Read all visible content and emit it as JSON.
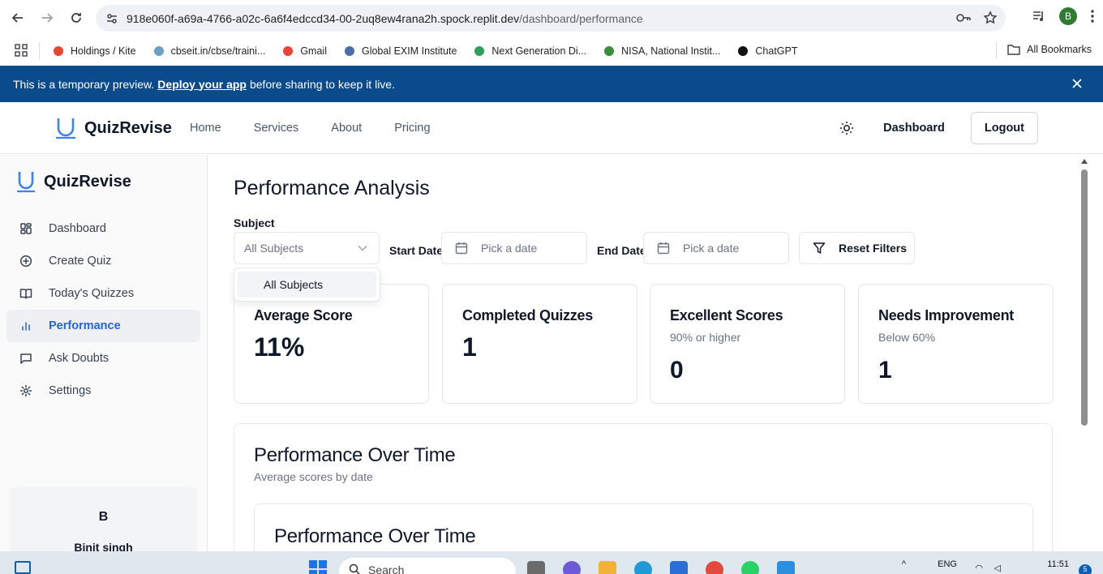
{
  "browser": {
    "url_host": "918e060f-a69a-4766-a02c-6a6f4edccd34-00-2uq8ew4rana2h.spock.replit.dev",
    "url_path": "/dashboard/performance",
    "profile_initial": "B",
    "bookmarks": [
      {
        "label": "Holdings / Kite",
        "icon": "kite-icon",
        "color": "#e8452c"
      },
      {
        "label": "cbseit.in/cbse/traini...",
        "icon": "cbse-icon",
        "color": "#6aa0c8"
      },
      {
        "label": "Gmail",
        "icon": "gmail-icon",
        "color": "#ea4335"
      },
      {
        "label": "Global EXIM Institute",
        "icon": "globe-icon",
        "color": "#4a6fa5"
      },
      {
        "label": "Next Generation Di...",
        "icon": "arrow-icon",
        "color": "#2e9e5b"
      },
      {
        "label": "NISA, National Instit...",
        "icon": "nisa-icon",
        "color": "#3b8d3b"
      },
      {
        "label": "ChatGPT",
        "icon": "chatgpt-icon",
        "color": "#111111"
      }
    ],
    "all_bookmarks": "All Bookmarks"
  },
  "banner": {
    "pre": "This is a temporary preview.",
    "link": "Deploy your app",
    "post": "before sharing to keep it live."
  },
  "header": {
    "brand": "QuizRevise",
    "nav": [
      "Home",
      "Services",
      "About",
      "Pricing"
    ],
    "dashboard": "Dashboard",
    "logout": "Logout"
  },
  "sidebar": {
    "brand": "QuizRevise",
    "items": [
      {
        "label": "Dashboard",
        "icon": "grid-icon",
        "active": false
      },
      {
        "label": "Create Quiz",
        "icon": "plus-circle-icon",
        "active": false
      },
      {
        "label": "Today's Quizzes",
        "icon": "book-open-icon",
        "active": false
      },
      {
        "label": "Performance",
        "icon": "bar-chart-icon",
        "active": true
      },
      {
        "label": "Ask Doubts",
        "icon": "message-square-icon",
        "active": false
      },
      {
        "label": "Settings",
        "icon": "gear-icon",
        "active": false
      }
    ],
    "user": {
      "initial": "B",
      "name": "Binit singh"
    }
  },
  "main": {
    "title": "Performance Analysis",
    "filters": {
      "subject_label": "Subject",
      "subject_value": "All Subjects",
      "subject_options": [
        "All Subjects"
      ],
      "start_label": "Start Date",
      "start_placeholder": "Pick a date",
      "end_label": "End Date",
      "end_placeholder": "Pick a date",
      "reset": "Reset Filters"
    },
    "cards": [
      {
        "title": "Average Score",
        "subtitle": "",
        "value": "11%"
      },
      {
        "title": "Completed Quizzes",
        "subtitle": "",
        "value": "1"
      },
      {
        "title": "Excellent Scores",
        "subtitle": "90% or higher",
        "value": "0"
      },
      {
        "title": "Needs Improvement",
        "subtitle": "Below 60%",
        "value": "1"
      }
    ],
    "panel": {
      "title": "Performance Over Time",
      "subtitle": "Average scores by date",
      "inner_title": "Performance Over Time"
    }
  },
  "taskbar": {
    "search": "Search",
    "lang": "ENG",
    "time": "11:51",
    "notifications": "5"
  },
  "colors": {
    "banner": "#0b4a8b",
    "accent": "#2563eb",
    "logo": "#3b82f6"
  }
}
